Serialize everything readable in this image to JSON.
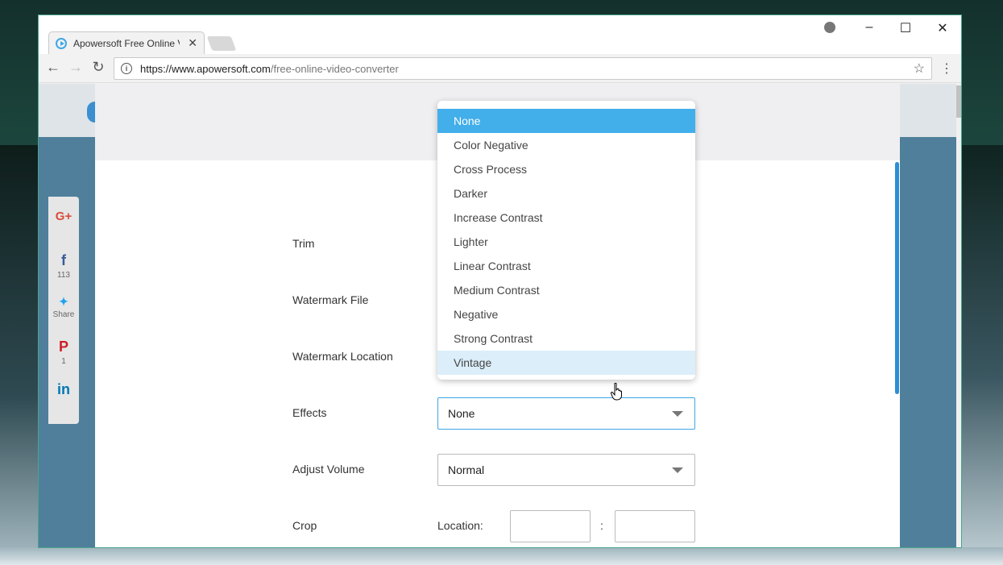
{
  "browser": {
    "tab_title": "Apowersoft Free Online V",
    "tab_close": "✕",
    "url_host": "https://www.apowersoft.com",
    "url_path": "/free-online-video-converter",
    "window_controls": [
      "–",
      "☐",
      "✕"
    ]
  },
  "share_bar": {
    "items": [
      {
        "icon": "google-plus-icon",
        "glyph": "G+",
        "count": "",
        "color": "#d94b3b"
      },
      {
        "icon": "facebook-icon",
        "glyph": "f",
        "count": "113",
        "color": "#3b5998"
      },
      {
        "icon": "twitter-icon",
        "glyph": "🐦",
        "count": "Share",
        "color": "#1da1f2"
      },
      {
        "icon": "pinterest-icon",
        "glyph": "P",
        "count": "1",
        "color": "#cb2027"
      },
      {
        "icon": "linkedin-icon",
        "glyph": "in",
        "count": "",
        "color": "#0077b5"
      }
    ]
  },
  "form": {
    "trim_label": "Trim",
    "watermark_file_label": "Watermark File",
    "watermark_location_label": "Watermark Location",
    "effects_label": "Effects",
    "effects_value": "None",
    "adjust_volume_label": "Adjust Volume",
    "adjust_volume_value": "Normal",
    "crop_label": "Crop",
    "location_label": "Location:",
    "location_sep": ":"
  },
  "effects_options": {
    "o0": "None",
    "o1": "Color Negative",
    "o2": "Cross Process",
    "o3": "Darker",
    "o4": "Increase Contrast",
    "o5": "Lighter",
    "o6": "Linear Contrast",
    "o7": "Medium Contrast",
    "o8": "Negative",
    "o9": "Strong Contrast",
    "o10": "Vintage",
    "selected": "None",
    "hovered": "Vintage"
  },
  "colors": {
    "accent": "#42aeea",
    "hover": "#dbeefa",
    "scroll_thumb": "#2c8fd6"
  }
}
